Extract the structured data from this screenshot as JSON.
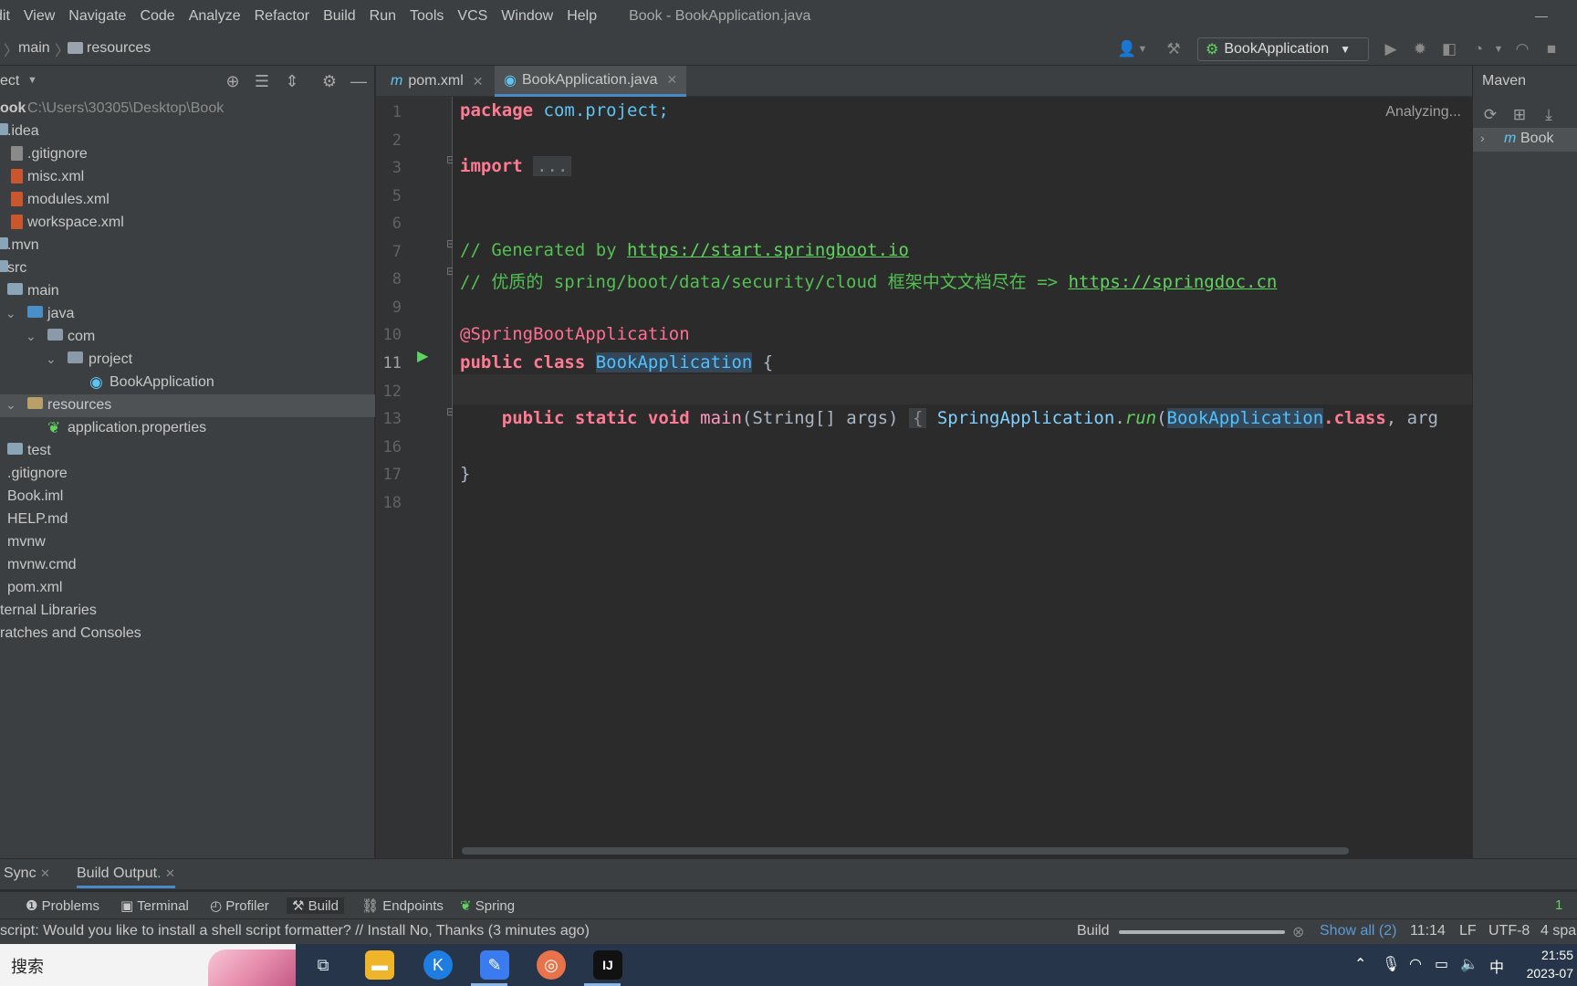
{
  "menu": {
    "items": [
      "dit",
      "View",
      "Navigate",
      "Code",
      "Analyze",
      "Refactor",
      "Build",
      "Run",
      "Tools",
      "VCS",
      "Window",
      "Help"
    ],
    "window_title": "Book - BookApplication.java"
  },
  "breadcrumb": {
    "items": [
      "main",
      "resources"
    ]
  },
  "run_config": {
    "label": "BookApplication"
  },
  "project_panel": {
    "title": "ect",
    "tree": [
      {
        "label": "ook",
        "extra": "C:\\Users\\30305\\Desktop\\Book"
      },
      {
        "label": ".idea"
      },
      {
        "label": ".gitignore"
      },
      {
        "label": "misc.xml"
      },
      {
        "label": "modules.xml"
      },
      {
        "label": "workspace.xml"
      },
      {
        "label": ".mvn"
      },
      {
        "label": "src"
      },
      {
        "label": "main"
      },
      {
        "label": "java"
      },
      {
        "label": "com"
      },
      {
        "label": "project"
      },
      {
        "label": "BookApplication"
      },
      {
        "label": "resources"
      },
      {
        "label": "application.properties"
      },
      {
        "label": "test"
      },
      {
        "label": ".gitignore"
      },
      {
        "label": "Book.iml"
      },
      {
        "label": "HELP.md"
      },
      {
        "label": "mvnw"
      },
      {
        "label": "mvnw.cmd"
      },
      {
        "label": "pom.xml"
      },
      {
        "label": "ternal Libraries"
      },
      {
        "label": "ratches and Consoles"
      }
    ]
  },
  "editor_tabs": [
    {
      "label": "pom.xml"
    },
    {
      "label": "BookApplication.java"
    }
  ],
  "editor": {
    "status": "Analyzing...",
    "line_numbers": [
      "1",
      "2",
      "3",
      "5",
      "6",
      "7",
      "8",
      "9",
      "10",
      "11",
      "12",
      "13",
      "16",
      "17",
      "18"
    ],
    "code": {
      "l1_kw": "package",
      "l1_pkg": "com.project;",
      "l3_kw": "import",
      "l3_fold": "...",
      "l7_cmt": "// Generated by ",
      "l7_url": "https://start.springboot.io",
      "l8_cmt": "// 优质的 spring/boot/data/security/cloud 框架中文文档尽在 => ",
      "l8_url": "https://springdoc.cn",
      "l10_ann": "@SpringBootApplication",
      "l11_kw": "public class",
      "l11_cls": "BookApplication",
      "l11_brace": "{",
      "l13_kw": "public static void",
      "l13_method": "main",
      "l13_sig": "(String[] args)",
      "l13_fold": "{",
      "l13_spring": "SpringApplication",
      "l13_dot": ".",
      "l13_run": "run",
      "l13_paren": "(",
      "l13_cls": "BookApplication",
      "l13_class": ".class",
      "l13_rest": ", arg",
      "l17": "}"
    }
  },
  "maven": {
    "title": "Maven",
    "root": "Book"
  },
  "build_panel": {
    "tabs": [
      "Sync",
      "Build Output"
    ]
  },
  "tool_windows": [
    "Problems",
    "Terminal",
    "Profiler",
    "Build",
    "Endpoints",
    "Spring"
  ],
  "status_bar": {
    "message": "script: Would you like to install a shell script formatter? // Install   No, Thanks (3 minutes ago)",
    "build_label": "Build",
    "show_all": "Show all (2)",
    "position": "11:14",
    "line_sep": "LF",
    "encoding": "UTF-8",
    "indent": "4 spa",
    "notif_count": "1"
  },
  "taskbar": {
    "search": "搜索",
    "clock_time": "21:55",
    "clock_date": "2023-07",
    "ime": "中"
  }
}
